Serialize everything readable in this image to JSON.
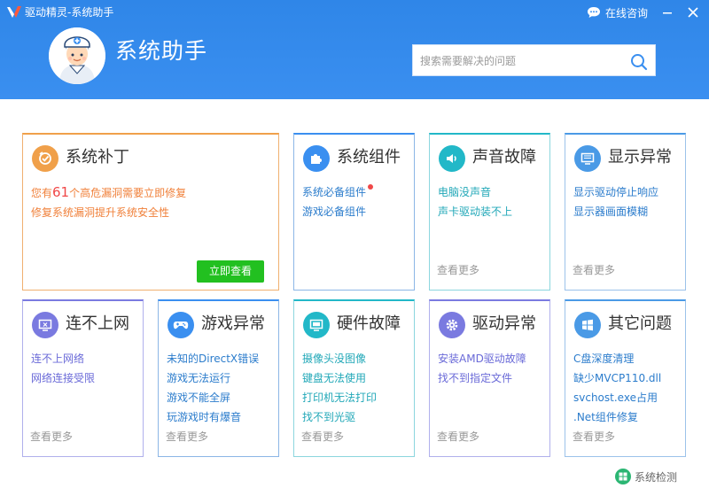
{
  "titlebar": {
    "app_title": "驱动精灵-系统助手",
    "chat_label": "在线咨询"
  },
  "header": {
    "brand_title": "系统助手",
    "search_placeholder": "搜索需要解决的问题"
  },
  "colors": {
    "header_blue": "#2f86e8",
    "patch_orange": "#f0a04a",
    "link_blue": "#2b7ccc",
    "teal": "#22b8c8",
    "purple": "#7a7ae0",
    "green": "#22c020",
    "red": "#f04848"
  },
  "cards": {
    "patch": {
      "title": "系统补丁",
      "desc_prefix": "您有",
      "count": "61",
      "desc_suffix": "个高危漏洞需要立即修复",
      "desc2": "修复系统漏洞提升系统安全性",
      "button": "立即查看"
    },
    "components": {
      "title": "系统组件",
      "links": [
        "系统必备组件",
        "游戏必备组件"
      ]
    },
    "sound": {
      "title": "声音故障",
      "links": [
        "电脑没声音",
        "声卡驱动装不上"
      ],
      "more": "查看更多"
    },
    "display": {
      "title": "显示异常",
      "links": [
        "显示驱动停止响应",
        "显示器画面模糊"
      ],
      "more": "查看更多"
    },
    "network": {
      "title": "连不上网",
      "links": [
        "连不上网络",
        "网络连接受限"
      ],
      "more": "查看更多"
    },
    "game": {
      "title": "游戏异常",
      "links": [
        "未知的DirectX错误",
        "游戏无法运行",
        "游戏不能全屏",
        "玩游戏时有爆音"
      ],
      "more": "查看更多"
    },
    "hardware": {
      "title": "硬件故障",
      "links": [
        "摄像头没图像",
        "键盘无法使用",
        "打印机无法打印",
        "找不到光驱"
      ],
      "more": "查看更多"
    },
    "driver": {
      "title": "驱动异常",
      "links": [
        "安装AMD驱动故障",
        "找不到指定文件"
      ],
      "more": "查看更多"
    },
    "other": {
      "title": "其它问题",
      "links": [
        "C盘深度清理",
        "缺少MVCP110.dll",
        "svchost.exe占用",
        ".Net组件修复"
      ],
      "more": "查看更多"
    }
  },
  "footer": {
    "system_check": "系统检测"
  }
}
